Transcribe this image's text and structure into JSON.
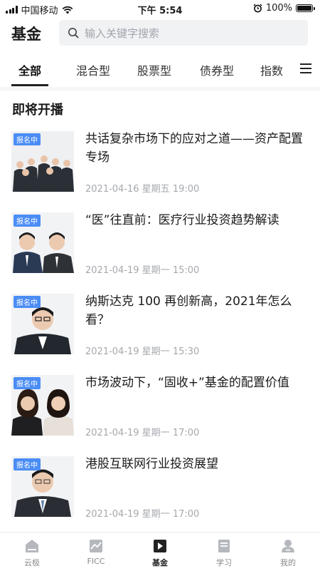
{
  "status_bar": {
    "carrier": "中国移动",
    "time": "下午 5:54",
    "battery": "100%"
  },
  "header": {
    "title": "基金",
    "search_placeholder": "输入关键字搜索"
  },
  "tabs": [
    {
      "label": "全部",
      "active": true
    },
    {
      "label": "混合型",
      "active": false
    },
    {
      "label": "股票型",
      "active": false
    },
    {
      "label": "债券型",
      "active": false
    },
    {
      "label": "指数",
      "active": false
    }
  ],
  "section": {
    "title": "即将开播"
  },
  "events": [
    {
      "badge": "报名中",
      "title": "共话复杂市场下的应对之道——资产配置专场",
      "time": "2021-04-16 星期五 19:00"
    },
    {
      "badge": "报名中",
      "title": "“医”往直前：医疗行业投资趋势解读",
      "time": "2021-04-19 星期一 15:00"
    },
    {
      "badge": "报名中",
      "title": "纳斯达克 100 再创新高，2021年怎么看？",
      "time": "2021-04-19 星期一 15:30"
    },
    {
      "badge": "报名中",
      "title": "市场波动下，“固收+”基金的配置价值",
      "time": "2021-04-19 星期一 17:00"
    },
    {
      "badge": "报名中",
      "title": "港股互联网行业投资展望",
      "time": "2021-04-19 星期一 17:00"
    }
  ],
  "bottom_nav": [
    {
      "label": "云极",
      "icon": "home-icon",
      "active": false
    },
    {
      "label": "FICC",
      "icon": "chart-icon",
      "active": false
    },
    {
      "label": "基金",
      "icon": "video-icon",
      "active": true
    },
    {
      "label": "学习",
      "icon": "book-icon",
      "active": false
    },
    {
      "label": "我的",
      "icon": "profile-icon",
      "active": false
    }
  ],
  "colors": {
    "accent": "#4b8df5",
    "text": "#1a1a1a",
    "muted": "#a5a8ad"
  }
}
